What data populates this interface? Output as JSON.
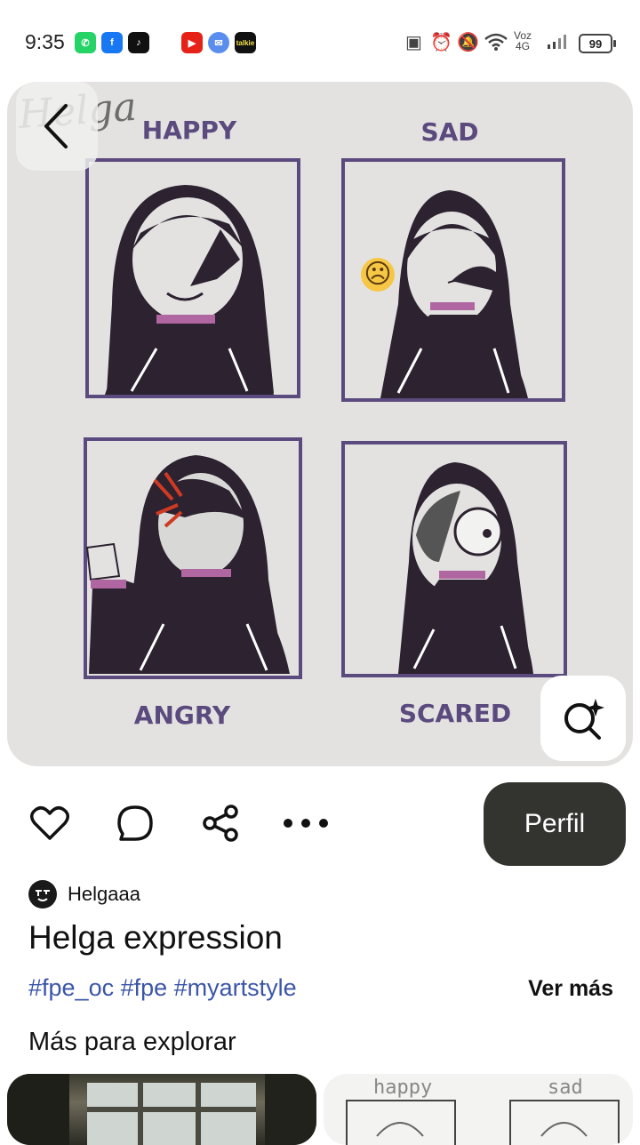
{
  "status": {
    "time": "9:35",
    "apps": [
      "whatsapp-icon",
      "facebook-icon",
      "tiktok-icon",
      "youtube-icon",
      "messenger-icon",
      "talkie-icon"
    ],
    "talkie_label": "talkie",
    "network_label_top": "Voz",
    "network_label_bottom": "4G",
    "battery": "99"
  },
  "pin": {
    "signature": "Helga",
    "panels": [
      {
        "label": "HAPPY"
      },
      {
        "label": "SAD"
      },
      {
        "label": "ANGRY"
      },
      {
        "label": "SCARED"
      }
    ],
    "sad_emoji": "☹"
  },
  "actions": {
    "perfil_label": "Perfil"
  },
  "author": {
    "name": "Helgaaa"
  },
  "post": {
    "title": "Helga expression",
    "tags": "#fpe_oc #fpe #myartstyle",
    "more_label": "Ver más"
  },
  "explore": {
    "heading": "Más para explorar",
    "thumb2_labels": [
      "happy",
      "sad"
    ]
  },
  "colors": {
    "accent_tag": "#3b55a8",
    "button_dark": "#333330",
    "panel_border": "#5b4a7e",
    "hair": "#2c2230"
  }
}
